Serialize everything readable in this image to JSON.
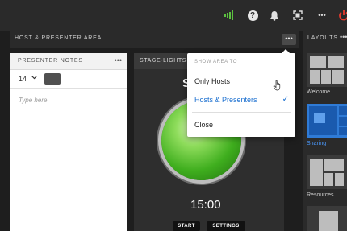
{
  "topbar": {
    "icons": [
      "signal-icon",
      "help-icon",
      "notification-bell-icon",
      "fullscreen-icon",
      "more-icon",
      "power-icon"
    ],
    "accent": "#5cc240"
  },
  "host_area": {
    "title": "HOST & PRESENTER AREA",
    "more": "•••"
  },
  "presenter_notes": {
    "title": "PRESENTER NOTES",
    "more": "•••",
    "font_size": "14",
    "placeholder": "Type here"
  },
  "stage_lights": {
    "title": "STAGE-LIGHTS-V",
    "big_text": "S",
    "timer": "15:00",
    "start_label": "START",
    "settings_label": "SETTINGS",
    "light_color": "#3fae1e"
  },
  "layouts": {
    "title": "LAYOUTS",
    "more": "•••",
    "items": [
      {
        "label": "Welcome",
        "selected": false
      },
      {
        "label": "Sharing",
        "selected": true
      },
      {
        "label": "Resources",
        "selected": false
      }
    ]
  },
  "menu": {
    "header": "SHOW AREA TO",
    "items": [
      {
        "label": "Only Hosts",
        "checked": false
      },
      {
        "label": "Hosts & Presenters",
        "checked": true
      },
      {
        "label": "Close",
        "checked": false
      }
    ],
    "check": "✓"
  }
}
